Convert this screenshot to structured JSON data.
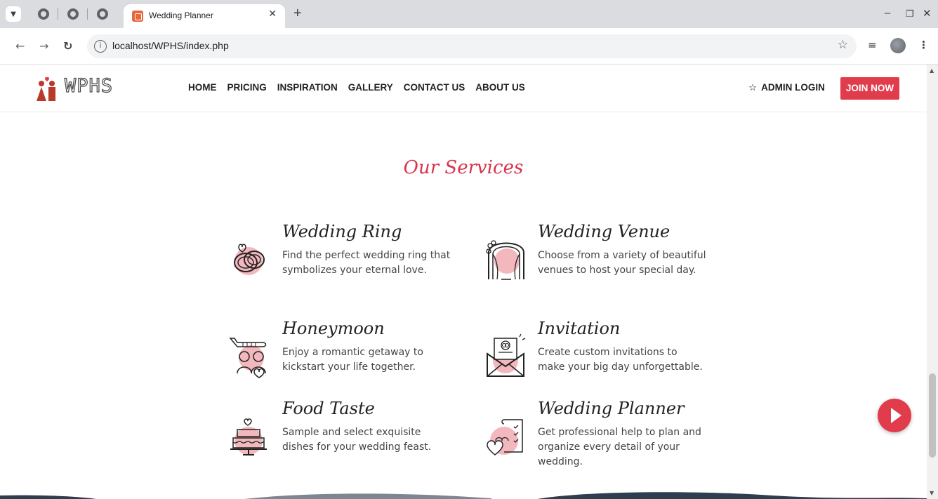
{
  "browser": {
    "tab_title": "Wedding Planner",
    "url": "localhost/WPHS/index.php"
  },
  "site": {
    "logo_text": "WPHS",
    "menu": [
      "HOME",
      "PRICING",
      "INSPIRATION",
      "GALLERY",
      "CONTACT US",
      "ABOUT US"
    ],
    "admin_login": "ADMIN LOGIN",
    "join_now": "JOIN NOW"
  },
  "services": {
    "title": "Our Services",
    "items": [
      {
        "title": "Wedding Ring",
        "desc": "Find the perfect wedding ring that symbolizes your eternal love.",
        "icon": "rings-icon"
      },
      {
        "title": "Wedding Venue",
        "desc": "Choose from a variety of beautiful venues to host your special day.",
        "icon": "arch-icon"
      },
      {
        "title": "Honeymoon",
        "desc": "Enjoy a romantic getaway to kickstart your life together.",
        "icon": "couple-plane-icon"
      },
      {
        "title": "Invitation",
        "desc": "Create custom invitations to make your big day unforgettable.",
        "icon": "envelope-icon"
      },
      {
        "title": "Food Taste",
        "desc": "Sample and select exquisite dishes for your wedding feast.",
        "icon": "cake-icon"
      },
      {
        "title": "Wedding Planner",
        "desc": "Get professional help to plan and organize every detail of your wedding.",
        "icon": "checklist-icon"
      }
    ]
  },
  "colors": {
    "accent": "#e03c4c",
    "title_red": "#d9334a",
    "icon_pink": "#f2b8bd"
  }
}
